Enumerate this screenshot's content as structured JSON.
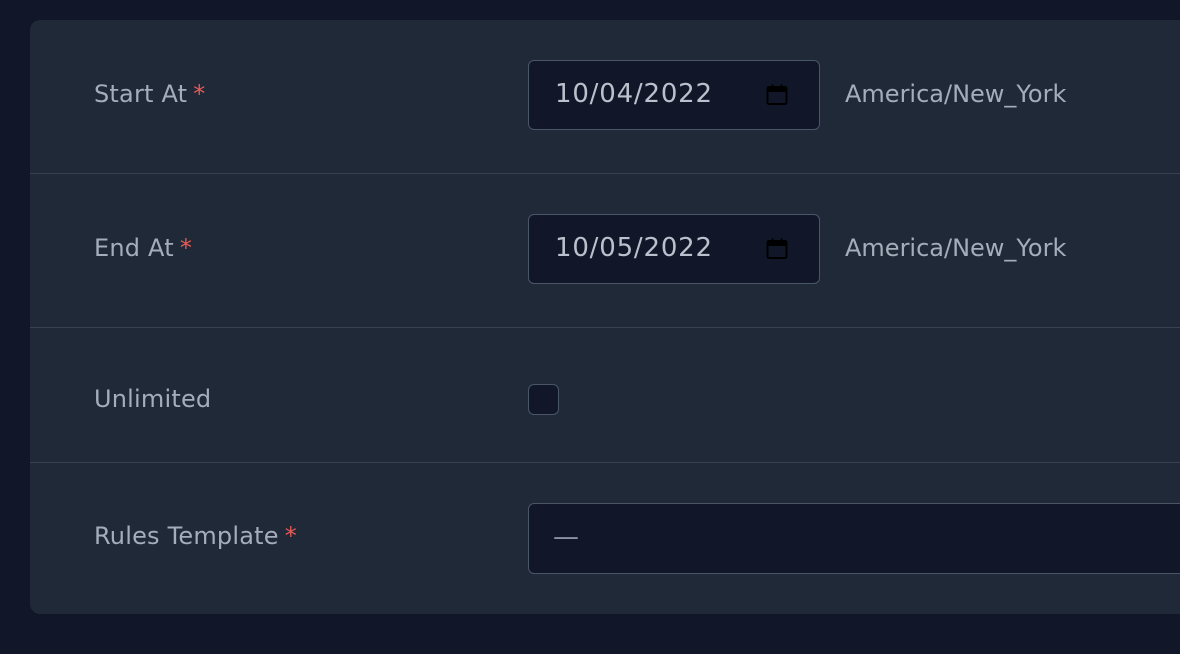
{
  "form": {
    "start_at": {
      "label": "Start At",
      "required_marker": "*",
      "value": "10/04/2022",
      "timezone": "America/New_York"
    },
    "end_at": {
      "label": "End At",
      "required_marker": "*",
      "value": "10/05/2022",
      "timezone": "America/New_York"
    },
    "unlimited": {
      "label": "Unlimited",
      "checked": false
    },
    "rules_template": {
      "label": "Rules Template",
      "required_marker": "*",
      "selected_value": "—"
    }
  },
  "icons": {
    "date_picker": "calendar-icon"
  },
  "colors": {
    "page_background": "#111729",
    "panel_background": "#1f2937",
    "required_marker": "#e45b56"
  }
}
